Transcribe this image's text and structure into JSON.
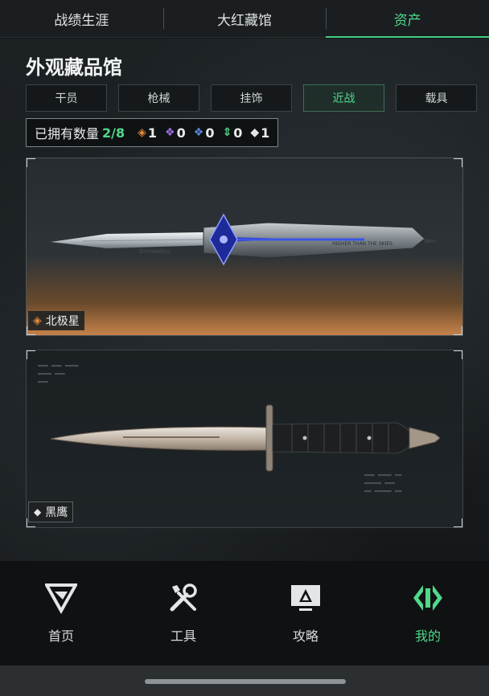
{
  "top_tabs": [
    {
      "label": "战绩生涯"
    },
    {
      "label": "大红藏馆"
    },
    {
      "label": "资产",
      "active": true
    }
  ],
  "page_title": "外观藏品馆",
  "categories": [
    {
      "label": "干员"
    },
    {
      "label": "枪械"
    },
    {
      "label": "挂饰"
    },
    {
      "label": "近战",
      "active": true
    },
    {
      "label": "载具"
    }
  ],
  "owned": {
    "label": "已拥有数量",
    "value": "2/8",
    "tiers": [
      {
        "icon": "orange-gem-icon",
        "color": "#e08a3c",
        "count": "1"
      },
      {
        "icon": "purple-gem-icon",
        "color": "#9b6ee0",
        "count": "0"
      },
      {
        "icon": "blue-gem-icon",
        "color": "#5a86d8",
        "count": "0"
      },
      {
        "icon": "green-gem-icon",
        "color": "#4fd98b",
        "count": "0"
      },
      {
        "icon": "white-gem-icon",
        "color": "#e6e6e6",
        "count": "1"
      }
    ]
  },
  "items": [
    {
      "name": "北极星",
      "rarity_icon": "orange-gem-icon",
      "rarity_color": "#e08a3c",
      "blade_engraving": "Dromedius",
      "handle_engraving": "HIGHER THAN THE SKIES"
    },
    {
      "name": "黑鹰",
      "rarity_icon": "white-gem-icon",
      "rarity_color": "#e6e6e6"
    }
  ],
  "bottom_nav": [
    {
      "label": "首页",
      "icon": "delta-logo-icon"
    },
    {
      "label": "工具",
      "icon": "tools-icon"
    },
    {
      "label": "攻略",
      "icon": "guide-monitor-icon"
    },
    {
      "label": "我的",
      "icon": "profile-diamond-icon",
      "active": true
    }
  ],
  "colors": {
    "accent": "#4fd98b",
    "background": "#16191b"
  }
}
